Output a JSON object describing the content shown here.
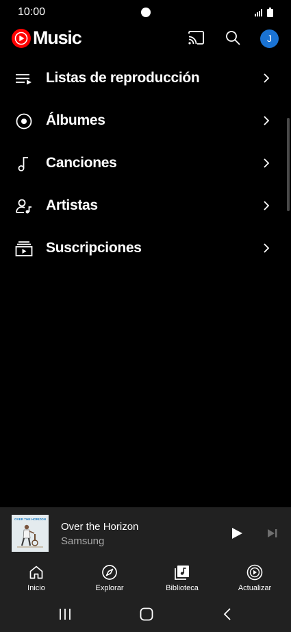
{
  "status_bar": {
    "time": "10:00"
  },
  "app": {
    "title": "Music",
    "avatar_letter": "J",
    "brand_color": "#ff0000",
    "avatar_color": "#1a73d4"
  },
  "menu": {
    "items": [
      {
        "label": "Listas de reproducción",
        "icon": "playlist-icon"
      },
      {
        "label": "Álbumes",
        "icon": "album-icon"
      },
      {
        "label": "Canciones",
        "icon": "music-note-icon"
      },
      {
        "label": "Artistas",
        "icon": "artist-icon"
      },
      {
        "label": "Suscripciones",
        "icon": "subscriptions-icon"
      }
    ]
  },
  "mini_player": {
    "title": "Over the Horizon",
    "artist": "Samsung",
    "art_text": "OVER THE HORIZON"
  },
  "bottom_nav": {
    "items": [
      {
        "label": "Inicio",
        "icon": "home-icon"
      },
      {
        "label": "Explorar",
        "icon": "compass-icon"
      },
      {
        "label": "Biblioteca",
        "icon": "library-icon"
      },
      {
        "label": "Actualizar",
        "icon": "upgrade-icon"
      }
    ]
  }
}
